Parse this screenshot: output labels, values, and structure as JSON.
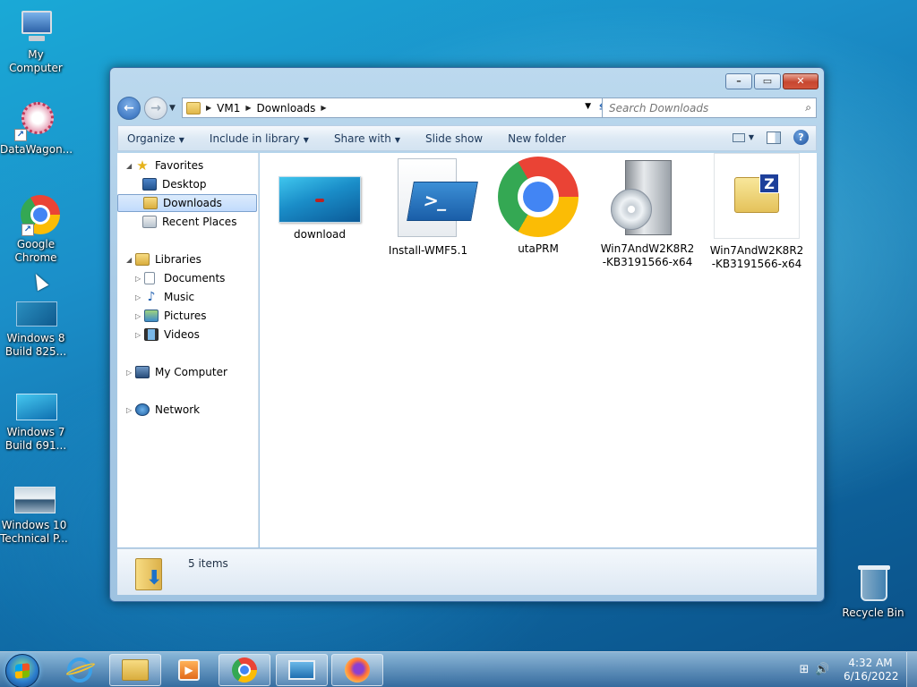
{
  "desktop": {
    "icons": [
      {
        "label": "My Computer"
      },
      {
        "label": "DataWagon..."
      },
      {
        "label_line1": "Google",
        "label_line2": "Chrome"
      },
      {
        "label_line1": "Windows 8",
        "label_line2": "Build 825..."
      },
      {
        "label_line1": "Windows 7",
        "label_line2": "Build 691..."
      },
      {
        "label_line1": "Windows 10",
        "label_line2": "Technical P..."
      },
      {
        "label": "Recycle Bin"
      }
    ]
  },
  "window": {
    "breadcrumb": [
      "VM1",
      "Downloads"
    ],
    "search_placeholder": "Search Downloads",
    "toolbar": {
      "organize": "Organize",
      "include_in_library": "Include in library",
      "share_with": "Share with",
      "slide_show": "Slide show",
      "new_folder": "New folder"
    },
    "nav": {
      "favorites": "Favorites",
      "desktop": "Desktop",
      "downloads": "Downloads",
      "recent_places": "Recent Places",
      "libraries": "Libraries",
      "documents": "Documents",
      "music": "Music",
      "pictures": "Pictures",
      "videos": "Videos",
      "my_computer": "My Computer",
      "network": "Network"
    },
    "files": [
      {
        "name": "download"
      },
      {
        "name": "Install-WMF5.1"
      },
      {
        "name": "utaPRM"
      },
      {
        "name_line1": "Win7AndW2K8R2",
        "name_line2": "-KB3191566-x64"
      },
      {
        "name_line1": "Win7AndW2K8R2",
        "name_line2": "-KB3191566-x64"
      }
    ],
    "details": {
      "item_count": "5 items"
    }
  },
  "taskbar": {
    "clock_time": "4:32 AM",
    "clock_date": "6/16/2022"
  },
  "colors": {
    "accent": "#3a6ea5",
    "selection": "#c1dbfc"
  }
}
